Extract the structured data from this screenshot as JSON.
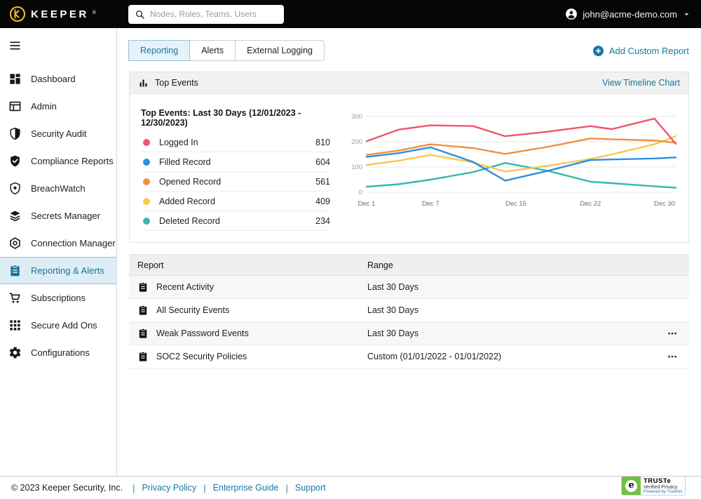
{
  "topbar": {
    "brand": "KEEPER",
    "brand_mark": "®",
    "search_placeholder": "Nodes, Roles, Teams, Users",
    "user_email": "john@acme-demo.com"
  },
  "sidebar": {
    "items": [
      {
        "label": "Dashboard",
        "icon": "dashboard-icon",
        "selected": false
      },
      {
        "label": "Admin",
        "icon": "admin-icon",
        "selected": false
      },
      {
        "label": "Security Audit",
        "icon": "security-audit-icon",
        "selected": false
      },
      {
        "label": "Compliance Reports",
        "icon": "compliance-reports-icon",
        "selected": false
      },
      {
        "label": "BreachWatch",
        "icon": "breachwatch-icon",
        "selected": false
      },
      {
        "label": "Secrets Manager",
        "icon": "secrets-manager-icon",
        "selected": false
      },
      {
        "label": "Connection Manager",
        "icon": "connection-manager-icon",
        "selected": false
      },
      {
        "label": "Reporting & Alerts",
        "icon": "reporting-alerts-icon",
        "selected": true
      },
      {
        "label": "Subscriptions",
        "icon": "subscriptions-icon",
        "selected": false
      },
      {
        "label": "Secure Add Ons",
        "icon": "secure-add-ons-icon",
        "selected": false
      },
      {
        "label": "Configurations",
        "icon": "configurations-icon",
        "selected": false
      }
    ]
  },
  "tabs": [
    {
      "label": "Reporting",
      "selected": true
    },
    {
      "label": "Alerts",
      "selected": false
    },
    {
      "label": "External Logging",
      "selected": false
    }
  ],
  "add_custom_report_label": "Add Custom Report",
  "top_events": {
    "panel_title": "Top Events",
    "view_timeline_label": "View Timeline Chart",
    "subtitle": "Top Events: Last 30 Days (12/01/2023 - 12/30/2023)",
    "legend": [
      {
        "label": "Logged In",
        "value": "810",
        "color": "#F2536F"
      },
      {
        "label": "Filled Record",
        "value": "604",
        "color": "#2D8FE0"
      },
      {
        "label": "Opened Record",
        "value": "561",
        "color": "#F2903F"
      },
      {
        "label": "Added Record",
        "value": "409",
        "color": "#F8C74F"
      },
      {
        "label": "Deleted Record",
        "value": "234",
        "color": "#34B9A9"
      }
    ]
  },
  "chart_data": {
    "type": "line",
    "title": "Top Events: Last 30 Days (12/01/2023 - 12/30/2023)",
    "x": [
      1,
      4,
      7,
      11,
      14,
      18,
      22,
      24,
      28,
      30
    ],
    "x_unit": "day of December",
    "x_tick_days": [
      1,
      7,
      15,
      22,
      30
    ],
    "x_tick_labels": [
      "Dec 1",
      "Dec 7",
      "Dec 15",
      "Dec 22",
      "Dec 30"
    ],
    "ylim": [
      0,
      300
    ],
    "yticks": [
      0,
      100,
      200,
      300
    ],
    "grid": true,
    "legend_position": "left-list",
    "series": [
      {
        "name": "Logged In",
        "color": "#F2536F",
        "values": [
          202,
          248,
          265,
          262,
          222,
          240,
          262,
          250,
          292,
          192
        ]
      },
      {
        "name": "Filled Record",
        "color": "#2D8FE0",
        "values": [
          140,
          155,
          178,
          120,
          46,
          85,
          128,
          130,
          134,
          138
        ]
      },
      {
        "name": "Opened Record",
        "color": "#F2903F",
        "values": [
          148,
          165,
          190,
          175,
          152,
          180,
          213,
          210,
          205,
          196
        ]
      },
      {
        "name": "Added Record",
        "color": "#F8C74F",
        "values": [
          108,
          125,
          148,
          118,
          82,
          105,
          132,
          150,
          190,
          222
        ]
      },
      {
        "name": "Deleted Record",
        "color": "#34B9A9",
        "values": [
          22,
          32,
          50,
          80,
          116,
          85,
          42,
          36,
          24,
          18
        ]
      }
    ]
  },
  "reports_table": {
    "columns": [
      "Report",
      "Range"
    ],
    "rows": [
      {
        "report": "Recent Activity",
        "range": "Last 30 Days",
        "menu": false
      },
      {
        "report": "All Security Events",
        "range": "Last 30 Days",
        "menu": false
      },
      {
        "report": "Weak Password Events",
        "range": "Last 30 Days",
        "menu": true
      },
      {
        "report": "SOC2 Security Policies",
        "range": "Custom (01/01/2022 - 01/01/2022)",
        "menu": true
      }
    ]
  },
  "footer": {
    "copyright": "© 2023 Keeper Security, Inc.",
    "links": [
      "Privacy Policy",
      "Enterprise Guide",
      "Support"
    ],
    "truste_title": "TRUSTe",
    "truste_sub": "Verified Privacy",
    "truste_powered": "Powered by TrustArc"
  },
  "colors": {
    "accent_blue": "#1577A5",
    "selected_sidebar_bg": "#DDEDF6",
    "brand_gold": "#F5B82E",
    "panel_header_gray": "#F1F1F1",
    "row_alt_gray": "#F7F7F7",
    "topbar_black": "#060606"
  }
}
